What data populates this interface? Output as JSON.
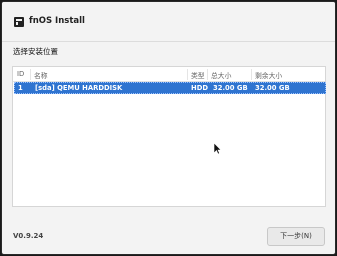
{
  "window": {
    "title": "fnOS Install",
    "app_icon": "fnos-logo-icon"
  },
  "section": {
    "label": "选择安装位置"
  },
  "table": {
    "columns": [
      "ID",
      "名称",
      "类型",
      "总大小",
      "剩余大小"
    ],
    "rows": [
      {
        "id": "1",
        "name": "[sda] QEMU HARDDISK",
        "type": "HDD",
        "total": "32.00 GB",
        "free": "32.00 GB",
        "selected": true
      }
    ]
  },
  "footer": {
    "version": "V0.9.24",
    "next_label": "下一步(N)"
  },
  "colors": {
    "selection": "#2f74d0",
    "window_bg": "#f3f3f3"
  }
}
